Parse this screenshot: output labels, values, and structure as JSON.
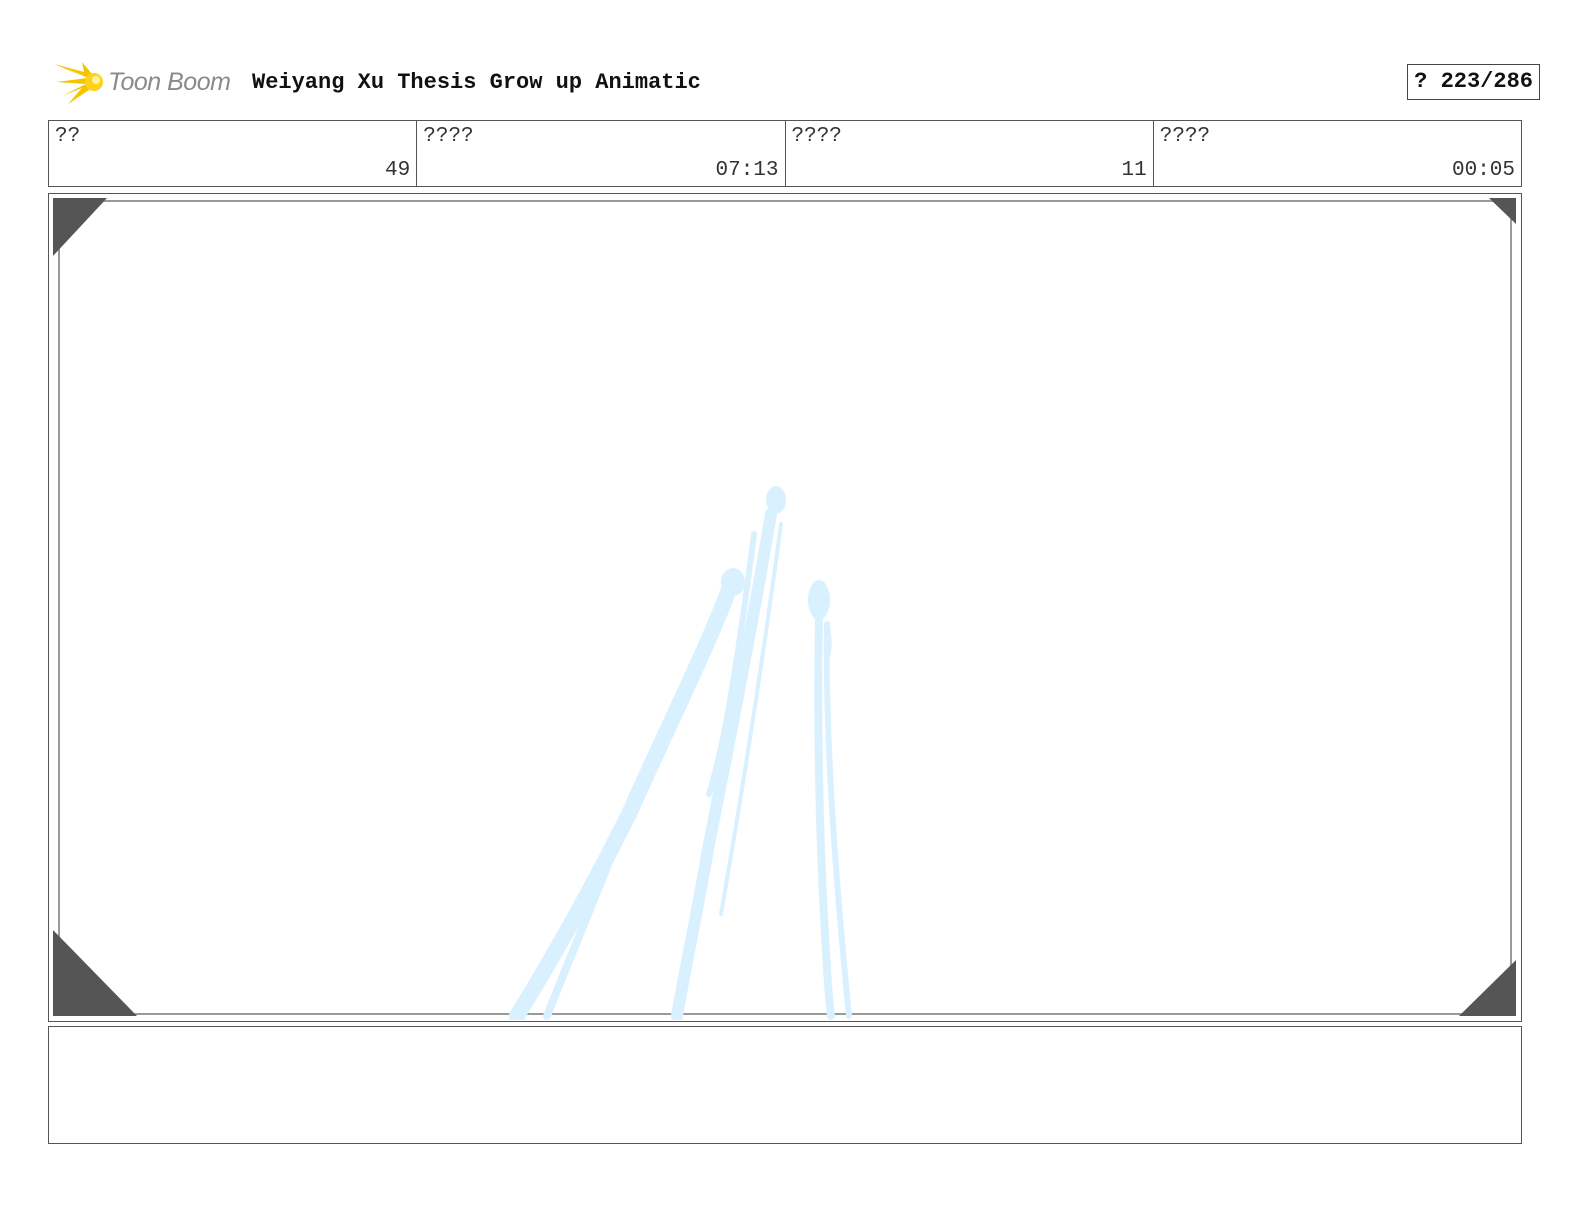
{
  "header": {
    "logo_text": "Toon Boom",
    "title": "Weiyang Xu Thesis Grow up Animatic",
    "page_counter": "? 223/286"
  },
  "info": [
    {
      "label": "??",
      "value": "49"
    },
    {
      "label": "????",
      "value": "07:13"
    },
    {
      "label": "????",
      "value": "11"
    },
    {
      "label": "????",
      "value": "00:05"
    }
  ],
  "notes": {
    "text": ""
  },
  "colors": {
    "logo_sun": "#f5c400",
    "sketch": "#d9f1ff",
    "corner": "#555555"
  }
}
